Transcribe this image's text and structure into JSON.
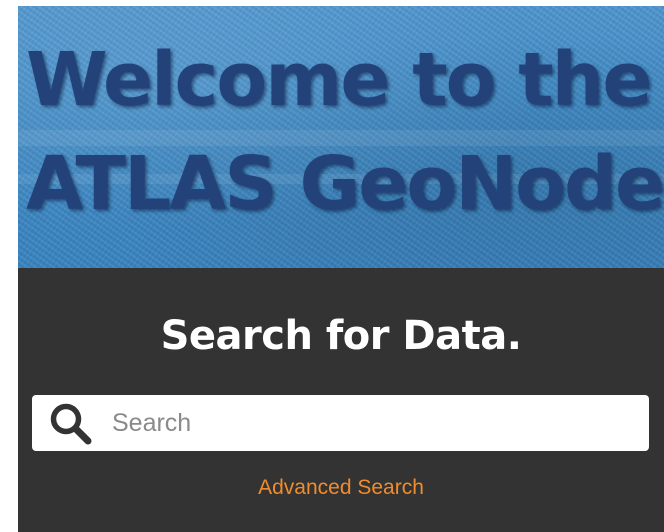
{
  "hero": {
    "title_line1": "Welcome to the",
    "title_line2": "ATLAS GeoNode"
  },
  "search": {
    "heading": "Search for Data.",
    "placeholder": "Search",
    "value": "",
    "icon": "search-icon",
    "advanced_label": "Advanced Search"
  },
  "colors": {
    "hero_bg": "#3f8cc9",
    "hero_text": "#24427a",
    "panel_bg": "#333333",
    "heading_text": "#ffffff",
    "link": "#f08c2d",
    "icon": "#333333"
  }
}
